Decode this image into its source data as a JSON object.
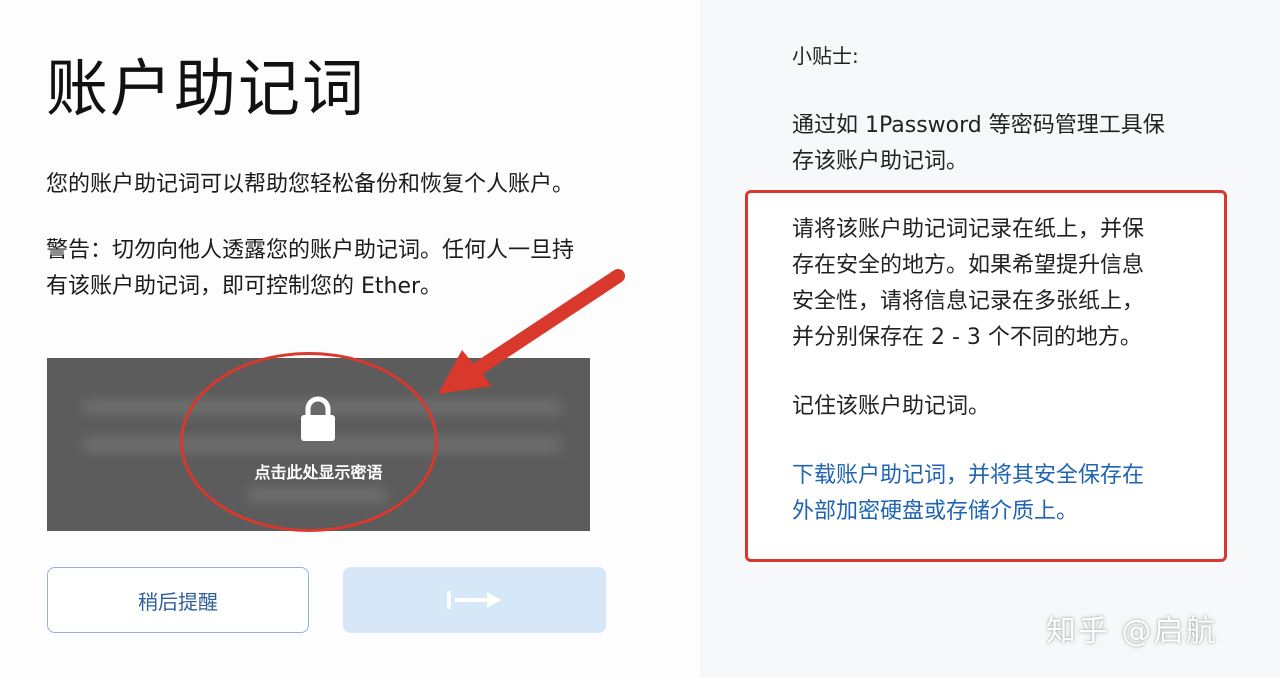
{
  "main": {
    "title": "账户助记词",
    "intro": "您的账户助记词可以帮助您轻松备份和恢复个人账户。",
    "warning_line1": "警告：切勿向他人透露您的账户助记词。任何人一旦持",
    "warning_line2": "有该账户助记词，即可控制您的 Ether。",
    "reveal_label": "点击此处显示密语",
    "remind_later_label": "稍后提醒"
  },
  "tips": {
    "title": "小贴士:",
    "tip1_line1": "通过如 1Password 等密码管理工具保",
    "tip1_line2": "存该账户助记词。",
    "tip2_line1": "请将该账户助记词记录在纸上，并保",
    "tip2_line2": "存在安全的地方。如果希望提升信息",
    "tip2_line3": "安全性，请将信息记录在多张纸上，",
    "tip2_line4": "并分别保存在 2 - 3 个不同的地方。",
    "tip3": "记住该账户助记词。",
    "download_line1": "下载账户助记词，并将其安全保存在",
    "download_line2": "外部加密硬盘或存储介质上。"
  },
  "watermark": "知乎 @启航",
  "icons": {
    "lock": "lock-icon",
    "next": "arrow-right-icon",
    "annotation_arrow": "red-arrow-annotation"
  },
  "colors": {
    "annotation_red": "#d9382d",
    "link_blue": "#1f64b3",
    "reveal_box": "#5c5c5c",
    "next_button": "#d6e7f8"
  }
}
